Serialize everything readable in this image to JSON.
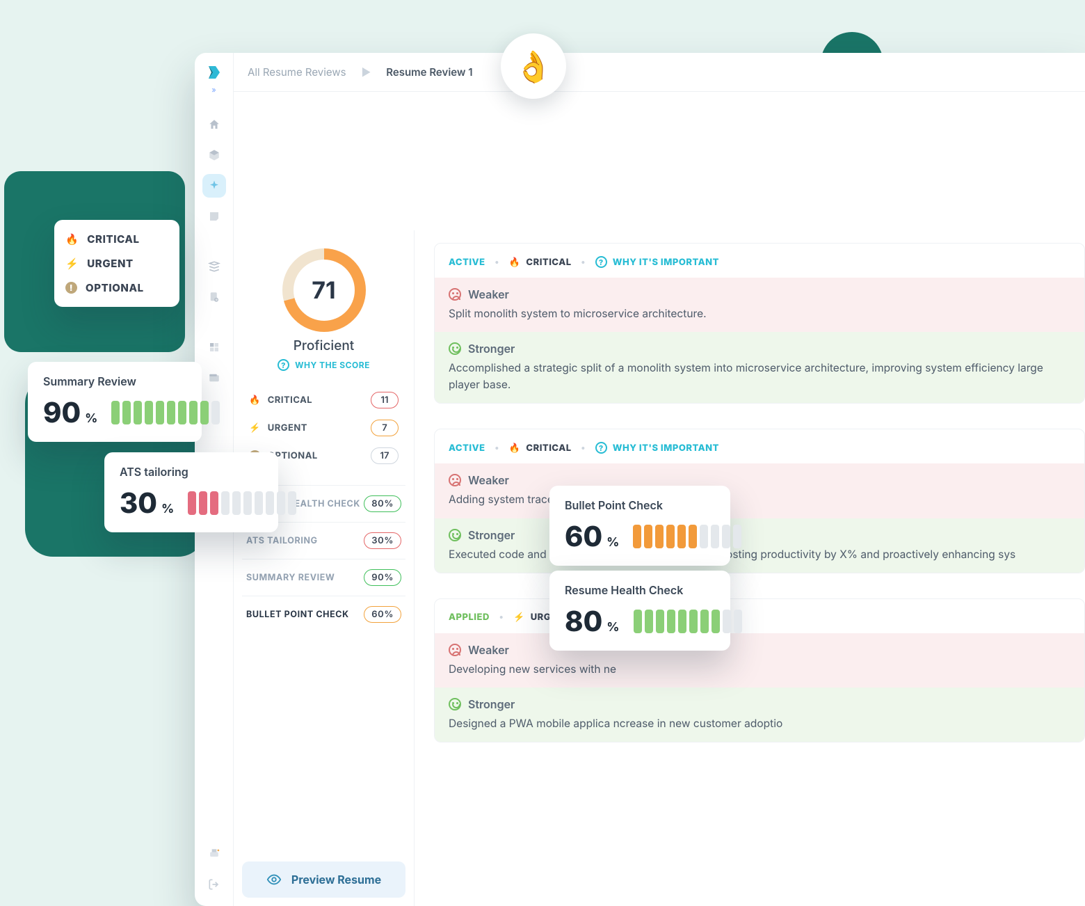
{
  "breadcrumbs": {
    "root": "All Resume Reviews",
    "current": "Resume Review 1"
  },
  "score": {
    "value": "71",
    "label": "Proficient",
    "why": "WHY THE SCORE"
  },
  "severity": {
    "critical": {
      "label": "CRITICAL",
      "count": "11"
    },
    "urgent": {
      "label": "URGENT",
      "count": "7"
    },
    "optional": {
      "label": "OPTIONAL",
      "count": "17"
    }
  },
  "checks": {
    "health": {
      "label": "RESUME HEALTH CHECK",
      "pct": "80%"
    },
    "ats": {
      "label": "ATS TAILORING",
      "pct": "30%"
    },
    "summary": {
      "label": "SUMMARY REVIEW",
      "pct": "90%"
    },
    "bullet": {
      "label": "BULLET POINT CHECK",
      "pct": "60%"
    }
  },
  "preview_label": "Preview Resume",
  "tags": {
    "active": "ACTIVE",
    "applied": "APPLIED",
    "critical": "CRITICAL",
    "urgent": "URGENT",
    "why": "WHY IT'S IMPORTANT",
    "weaker": "Weaker",
    "stronger": "Stronger"
  },
  "issues": [
    {
      "status": "ACTIVE",
      "severity": "CRITICAL",
      "weaker": "Split monolith system to microservice architecture.",
      "stronger": "Accomplished a strategic split of a monolith system into microservice architecture, improving system efficiency large player base."
    },
    {
      "status": "ACTIVE",
      "severity": "CRITICAL",
      "weaker": "Adding system traces and alerts for better durability.",
      "stronger": "Executed code and release management initiatives, boosting productivity by X% and proactively enhancing sys"
    },
    {
      "status": "APPLIED",
      "severity": "URGENT",
      "weaker": "Developing new services with ne",
      "stronger": "Designed a PWA mobile applica                                                                         ncrease in new customer adoptio"
    }
  ],
  "floats": {
    "summary": {
      "title": "Summary Review",
      "pct": "90",
      "segments": 10,
      "filled": 9,
      "color": "g"
    },
    "ats": {
      "title": "ATS tailoring",
      "pct": "30",
      "segments": 10,
      "filled": 3,
      "color": "r"
    },
    "bullet": {
      "title": "Bullet Point Check",
      "pct": "60",
      "segments": 10,
      "filled": 6,
      "color": "o"
    },
    "health": {
      "title": "Resume Health Check",
      "pct": "80",
      "segments": 10,
      "filled": 8,
      "color": "g"
    }
  },
  "legend": {
    "critical": "CRITICAL",
    "urgent": "URGENT",
    "optional": "OPTIONAL"
  },
  "ok_emoji": "👌"
}
